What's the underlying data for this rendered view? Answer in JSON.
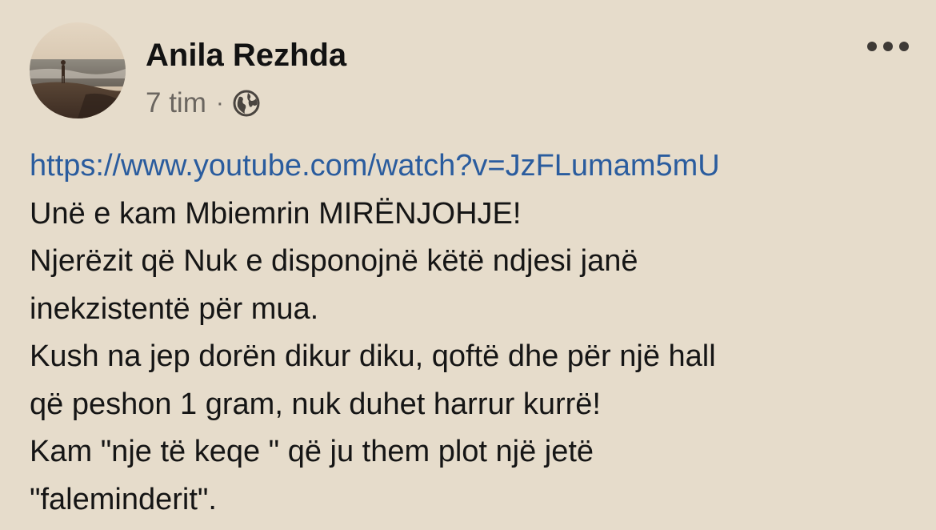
{
  "post": {
    "author": {
      "name": "Anila Rezhda",
      "avatar_icon": "profile-photo-beach"
    },
    "meta": {
      "time": "7 tim",
      "separator": "·",
      "audience_icon": "globe-icon"
    },
    "more_icon": "more-options-icon",
    "link": "https://www.youtube.com/watch?v=JzFLumam5mU",
    "lines": [
      "Unë e kam Mbiemrin MIRËNJOHJE!",
      "Njerëzit që Nuk e disponojnë këtë ndjesi janë",
      "inekzistentë për mua.",
      "Kush na jep dorën dikur diku, qoftë dhe për një hall",
      "që peshon 1 gram, nuk duhet harrur kurrë!",
      "Kam \"nje të keqe \" që ju them plot një jetë",
      "\"faleminderit\"."
    ]
  },
  "colors": {
    "background": "#e6dccb",
    "link": "#2a5c9e",
    "meta_text": "#6b6660",
    "text": "#151515"
  }
}
